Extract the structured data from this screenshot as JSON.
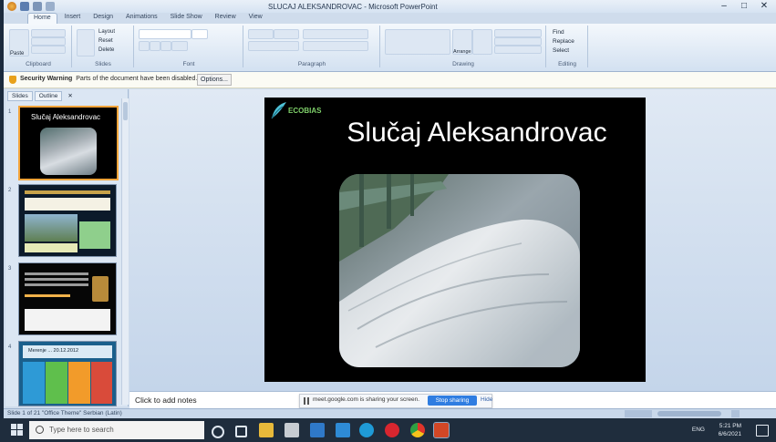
{
  "window": {
    "title": "SLUCAJ ALEKSANDROVAC - Microsoft PowerPoint",
    "controls": [
      "–",
      "□",
      "✕"
    ]
  },
  "ribbon": {
    "tabs": [
      "Home",
      "Insert",
      "Design",
      "Animations",
      "Slide Show",
      "Review",
      "View"
    ],
    "groups": [
      "Clipboard",
      "Slides",
      "Font",
      "Paragraph",
      "Drawing",
      "Editing"
    ],
    "paste": "Paste",
    "new_slide": "New Slide",
    "layout": "Layout",
    "reset": "Reset",
    "delete": "Delete",
    "find": "Find",
    "replace": "Replace",
    "select": "Select",
    "arrange": "Arrange",
    "quick_styles": "Quick Styles"
  },
  "security_bar": {
    "label": "Security Warning",
    "message": "Parts of the document have been disabled.",
    "options_button": "Options..."
  },
  "left_pane": {
    "tabs": [
      "Slides",
      "Outline"
    ],
    "thumbnails": [
      {
        "number": "1",
        "title": "Slučaj Aleksandrovac"
      },
      {
        "number": "2",
        "title": ""
      },
      {
        "number": "3",
        "title": ""
      },
      {
        "number": "4",
        "title": "Merenje ... 20.12.2012"
      }
    ]
  },
  "slide": {
    "logo": "ECOBIAS",
    "title": "Slučaj Aleksandrovac"
  },
  "notes": {
    "placeholder": "Click to add notes"
  },
  "screen_share": {
    "message": "meet.google.com is sharing your screen.",
    "stop_button": "Stop sharing",
    "hide": "Hide"
  },
  "status_bar": {
    "text": "Slide 1 of 21   \"Office Theme\"   Serbian (Latin)"
  },
  "taskbar": {
    "search_placeholder": "Type here to search",
    "time": "5:21 PM",
    "date": "6/6/2021",
    "lang": "ENG"
  }
}
